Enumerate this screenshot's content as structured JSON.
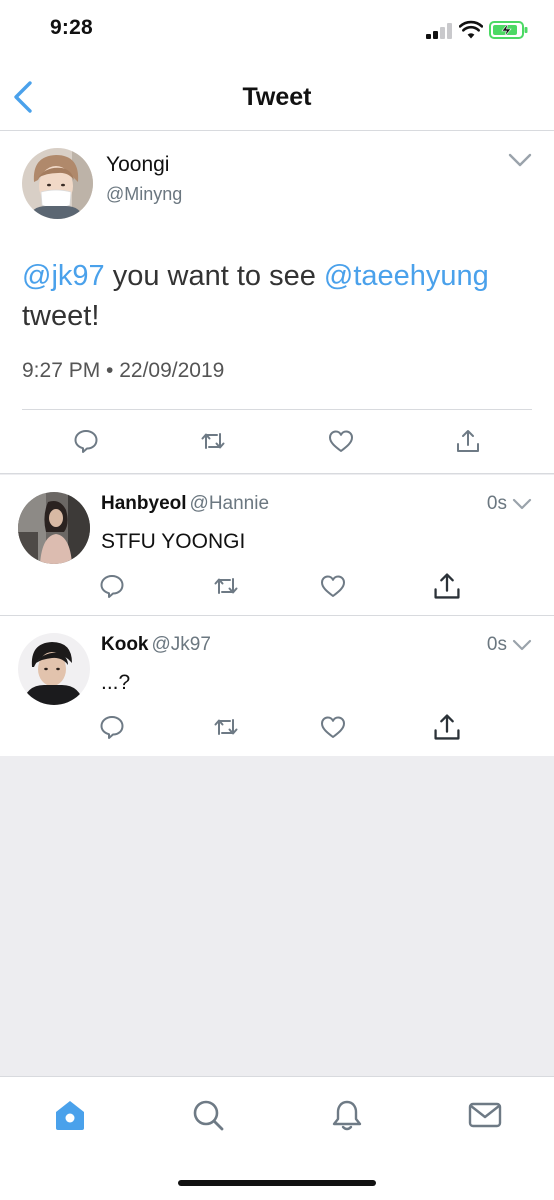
{
  "status_bar": {
    "time": "9:28",
    "icons": [
      "cellular-signal-icon",
      "wifi-icon",
      "battery-charging-icon"
    ]
  },
  "nav": {
    "title": "Tweet",
    "back_icon": "chevron-left-icon"
  },
  "main_tweet": {
    "name": "Yoongi",
    "handle": "@Minyng",
    "mention_1": "@jk97",
    "text_1": " you want to see ",
    "mention_2": "@taeehyung",
    "text_2": " tweet!",
    "timestamp": "9:27 PM • 22/09/2019",
    "actions": [
      "reply-icon",
      "retweet-icon",
      "like-icon",
      "share-icon"
    ]
  },
  "replies": [
    {
      "name": "Hanbyeol",
      "handle": "@Hannie",
      "time": "0s",
      "text": "STFU YOONGI"
    },
    {
      "name": "Kook",
      "handle": "@Jk97",
      "time": "0s",
      "text": "...?"
    }
  ],
  "tab_bar": {
    "tabs": [
      "home-icon",
      "search-icon",
      "notifications-icon",
      "messages-icon"
    ],
    "active": "home-icon"
  },
  "colors": {
    "accent": "#4aa1eb",
    "muted_text": "#6b7780",
    "icon_gray": "#6e7a85",
    "background": "#ededf0",
    "battery_green": "#4cd964"
  }
}
